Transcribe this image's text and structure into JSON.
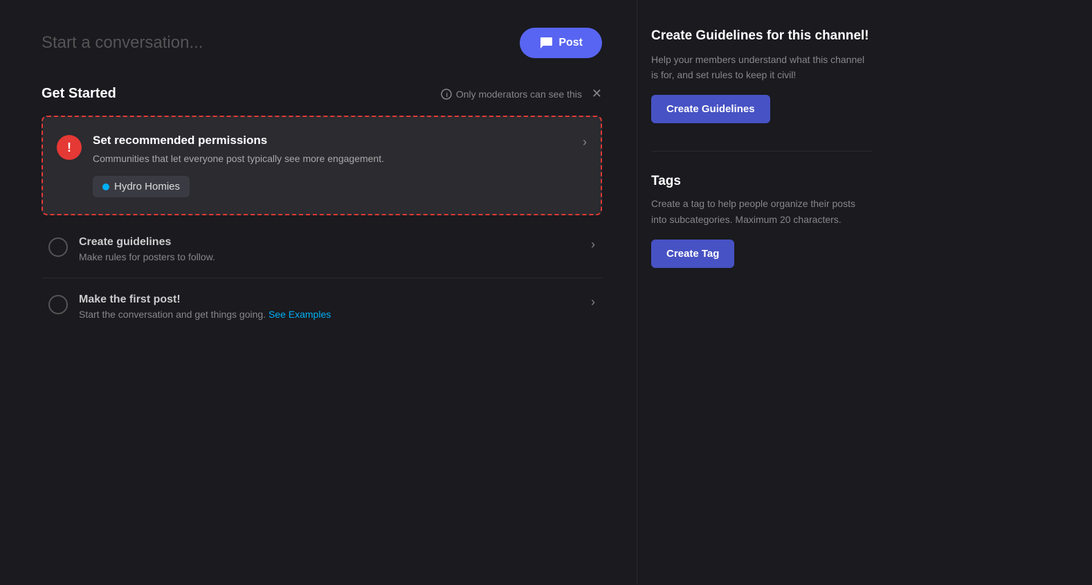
{
  "topbar": {
    "placeholder": "Start a conversation...",
    "post_button": "Post"
  },
  "get_started": {
    "title": "Get Started",
    "moderator_notice": "Only moderators can see this"
  },
  "highlight_card": {
    "title": "Set recommended permissions",
    "description": "Communities that let everyone post typically see more engagement.",
    "tag_label": "Hydro Homies"
  },
  "checklist": [
    {
      "title": "Create guidelines",
      "description": "Make rules for posters to follow.",
      "see_examples_link": null
    },
    {
      "title": "Make the first post!",
      "description": "Start the conversation and get things going.",
      "see_examples_label": "See Examples"
    }
  ],
  "right_panel": {
    "guidelines_section": {
      "title": "Create Guidelines for this channel!",
      "description": "Help your members understand what this channel is for, and set rules to keep it civil!",
      "button_label": "Create Guidelines"
    },
    "tags_section": {
      "title": "Tags",
      "description": "Create a tag to help people organize their posts into subcategories. Maximum 20 characters.",
      "button_label": "Create Tag"
    }
  }
}
